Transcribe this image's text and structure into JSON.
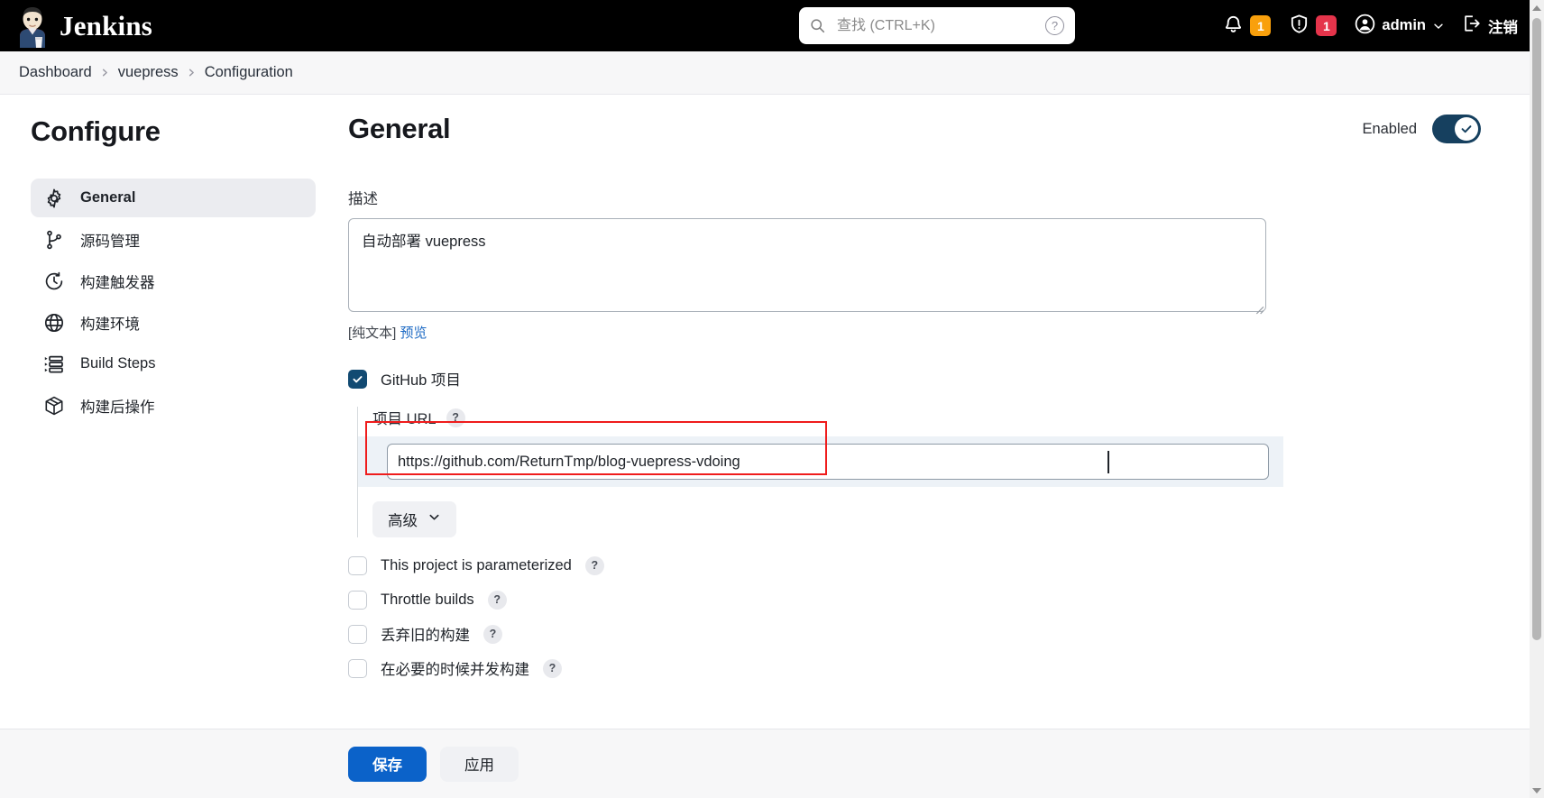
{
  "topbar": {
    "brand_title": "Jenkins",
    "search": {
      "placeholder": "查找 (CTRL+K)",
      "value": "",
      "help_label": "?"
    },
    "notifications_badge": "1",
    "security_badge": "1",
    "user_name": "admin",
    "logout_label": "注销"
  },
  "breadcrumb": {
    "items": [
      {
        "label": "Dashboard"
      },
      {
        "label": "vuepress"
      },
      {
        "label": "Configuration"
      }
    ],
    "separator": "›"
  },
  "sidebar": {
    "title": "Configure",
    "items": [
      {
        "label": "General",
        "icon": "gear-icon",
        "active": true
      },
      {
        "label": "源码管理",
        "icon": "source-branch-icon",
        "active": false
      },
      {
        "label": "构建触发器",
        "icon": "clock-icon",
        "active": false
      },
      {
        "label": "构建环境",
        "icon": "globe-icon",
        "active": false
      },
      {
        "label": "Build Steps",
        "icon": "list-steps-icon",
        "active": false
      },
      {
        "label": "构建后操作",
        "icon": "package-icon",
        "active": false
      }
    ]
  },
  "main": {
    "title": "General",
    "enabled_label": "Enabled",
    "enabled_state": "on",
    "description": {
      "label": "描述",
      "value": "自动部署 vuepress",
      "plaintext_note": "[纯文本]",
      "preview_link": "预览"
    },
    "github_project": {
      "label": "GitHub 项目",
      "checked": true,
      "url_label": "项目 URL",
      "url_help": "?",
      "url_value": "https://github.com/ReturnTmp/blog-vuepress-vdoing",
      "advanced_label": "高级"
    },
    "options": [
      {
        "label": "This project is parameterized",
        "help": "?",
        "checked": false
      },
      {
        "label": "Throttle builds",
        "help": "?",
        "checked": false
      },
      {
        "label": "丢弃旧的构建",
        "help": "?",
        "checked": false
      },
      {
        "label": "在必要的时候并发构建",
        "help": "?",
        "checked": false
      }
    ]
  },
  "footer": {
    "save_label": "保存",
    "apply_label": "应用"
  },
  "colors": {
    "topbar_bg": "#000000",
    "accent_blue": "#0b62c9",
    "toggle_on": "#16405f",
    "checkbox_checked": "#124a72",
    "badge_orange": "#f9a00c",
    "badge_red": "#e5344b",
    "annotation_red": "#ef1c1c",
    "link_blue": "#1d6ac4",
    "highlight_row": "#edf2f7"
  }
}
